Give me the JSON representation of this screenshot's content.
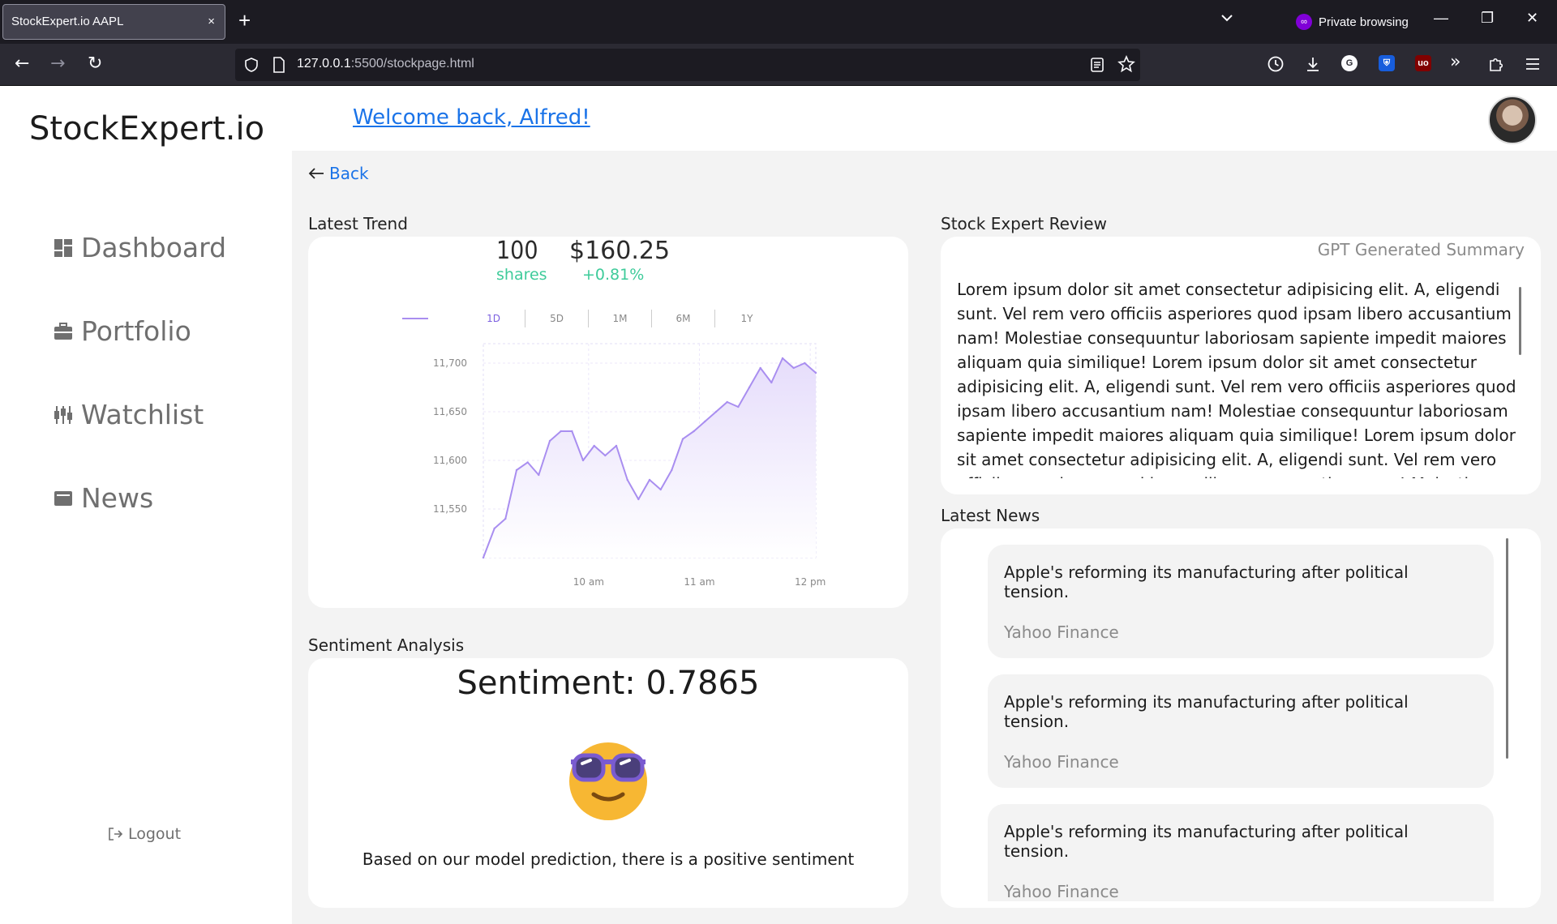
{
  "browser": {
    "tab_title": "StockExpert.io AAPL",
    "tab_close": "×",
    "new_tab": "+",
    "private_label": "Private browsing",
    "url_host": "127.0.0.1",
    "url_path": ":5500/stockpage.html",
    "minimize": "—",
    "restore": "❐",
    "close": "✕"
  },
  "brand": "StockExpert.io",
  "welcome": "Welcome back, Alfred!",
  "sidebar": {
    "items": [
      {
        "label": "Dashboard",
        "icon": "dashboard-icon"
      },
      {
        "label": "Portfolio",
        "icon": "briefcase-icon"
      },
      {
        "label": "Watchlist",
        "icon": "candlestick-icon"
      },
      {
        "label": "News",
        "icon": "newspaper-icon"
      }
    ],
    "logout": "Logout"
  },
  "back_label": "Back",
  "trend": {
    "section_label": "Latest Trend",
    "shares_value": "100",
    "shares_label": "shares",
    "price": "$160.25",
    "change": "+0.81%",
    "ranges": [
      "1D",
      "5D",
      "1M",
      "6M",
      "1Y"
    ],
    "active_range": "1D"
  },
  "chart_data": {
    "type": "area",
    "title": "",
    "xlabel": "",
    "ylabel": "",
    "ylim": [
      11500,
      11720
    ],
    "y_ticks": [
      "11,700",
      "11,650",
      "11,600",
      "11,550"
    ],
    "y_tick_values": [
      11700,
      11650,
      11600,
      11550
    ],
    "x_tick_labels": [
      "10 am",
      "11 am",
      "12 pm"
    ],
    "x_tick_positions": [
      9.5,
      19.5,
      29.5
    ],
    "series": [
      {
        "values": [
          11500,
          11530,
          11540,
          11590,
          11598,
          11585,
          11620,
          11630,
          11630,
          11600,
          11615,
          11605,
          11615,
          11580,
          11560,
          11580,
          11570,
          11590,
          11622,
          11630,
          11640,
          11650,
          11660,
          11655,
          11675,
          11695,
          11680,
          11705,
          11695,
          11700,
          11690
        ]
      }
    ],
    "line_color": "#a98ef0",
    "fill_color": "#e6ddfb",
    "grid": true
  },
  "sentiment": {
    "section_label": "Sentiment Analysis",
    "title": "Sentiment: 0.7865",
    "emoji": "smiling-face-with-sunglasses",
    "text": "Based on our model prediction, there is a positive sentiment"
  },
  "review": {
    "section_label": "Stock Expert Review",
    "summary_label": "GPT Generated Summary",
    "text": "Lorem ipsum dolor sit amet consectetur adipisicing elit. A, eligendi sunt. Vel rem vero officiis asperiores quod ipsam libero accusantium nam! Molestiae consequuntur laboriosam sapiente impedit maiores aliquam quia similique! Lorem ipsum dolor sit amet consectetur adipisicing elit. A, eligendi sunt. Vel rem vero officiis asperiores quod ipsam libero accusantium nam! Molestiae consequuntur laboriosam sapiente impedit maiores aliquam quia similique! Lorem ipsum dolor sit amet consectetur adipisicing elit. A, eligendi sunt. Vel rem vero officiis asperiores quod ipsam libero accusantium nam! Molestiae consequuntur laboriosam sapiente impedit maiores aliquam quia similique!"
  },
  "news": {
    "section_label": "Latest News",
    "items": [
      {
        "headline": "Apple's reforming its manufacturing after political tension.",
        "source": "Yahoo Finance"
      },
      {
        "headline": "Apple's reforming its manufacturing after political tension.",
        "source": "Yahoo Finance"
      },
      {
        "headline": "Apple's reforming its manufacturing after political tension.",
        "source": "Yahoo Finance"
      }
    ]
  },
  "colors": {
    "link": "#1a73e8",
    "positive": "#3ecb9a",
    "chart_line": "#a98ef0",
    "content_bg": "#f3f3f3"
  }
}
